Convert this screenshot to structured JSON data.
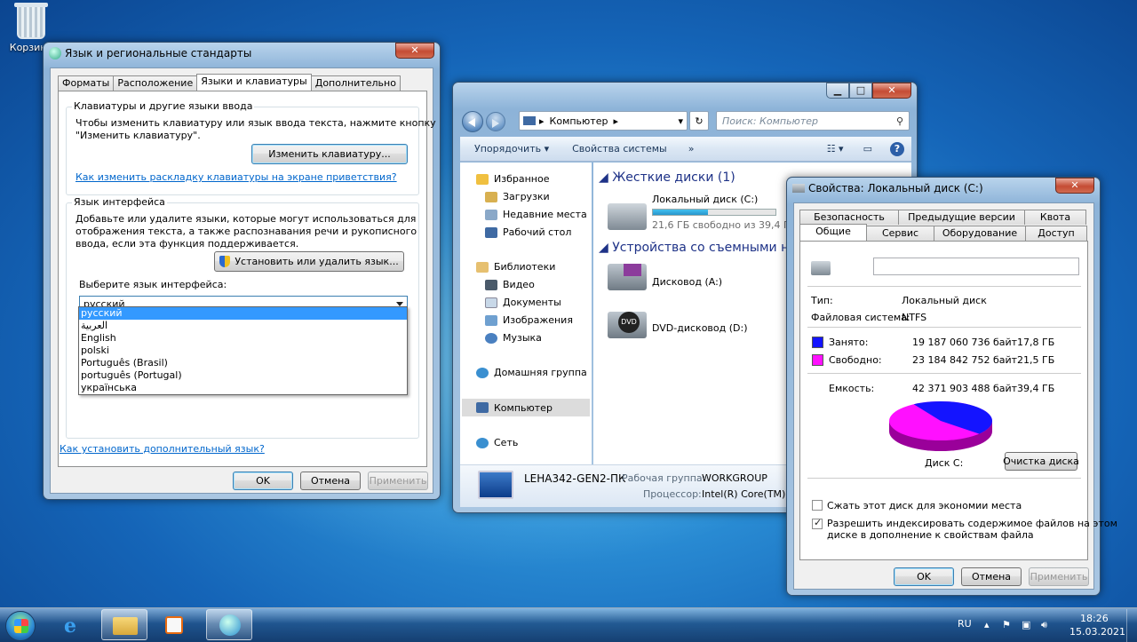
{
  "desktop": {
    "recycle_bin_label": "Корзина"
  },
  "lang_dialog": {
    "title": "Язык и региональные стандарты",
    "tabs": [
      "Форматы",
      "Расположение",
      "Языки и клавиатуры",
      "Дополнительно"
    ],
    "kb_group": {
      "title": "Клавиатуры и другие языки ввода",
      "desc1": "Чтобы изменить клавиатуру или язык ввода текста, нажмите кнопку",
      "desc2": "\"Изменить клавиатуру\".",
      "button": "Изменить клавиатуру...",
      "link": "Как изменить раскладку клавиатуры на экране приветствия?"
    },
    "ui_group": {
      "title": "Язык интерфейса",
      "desc1": "Добавьте или удалите языки, которые могут использоваться для",
      "desc2": "отображения текста, а также распознавания речи и рукописного",
      "desc3": "ввода, если эта функция поддерживается.",
      "button": "Установить или удалить язык...",
      "select_label": "Выберите язык интерфейса:",
      "selected": "русский",
      "options": [
        "русский",
        "العربية",
        "English",
        "polski",
        "Português (Brasil)",
        "português (Portugal)",
        "українська"
      ]
    },
    "link_install": "Как установить дополнительный язык?",
    "ok": "OK",
    "cancel": "Отмена",
    "apply": "Применить"
  },
  "explorer": {
    "breadcrumb": "Компьютер",
    "search_placeholder": "Поиск: Компьютер",
    "commands": [
      "Упорядочить ▾",
      "Свойства системы",
      "»"
    ],
    "nav": {
      "favorites": "Избранное",
      "downloads": "Загрузки",
      "recent": "Недавние места",
      "desktop": "Рабочий стол",
      "libraries": "Библиотеки",
      "video": "Видео",
      "documents": "Документы",
      "images": "Изображения",
      "music": "Музыка",
      "homegroup": "Домашняя группа",
      "computer": "Компьютер",
      "network": "Сеть"
    },
    "hdd_header": "Жесткие диски (1)",
    "local_disk": "Локальный диск (C:)",
    "local_disk_free": "21,6 ГБ свободно из 39,4 ГБ",
    "local_disk_used_pct": 45,
    "removable_header": "Устройства со съемными носителями",
    "floppy": "Дисковод (A:)",
    "dvd": "DVD-дисковод (D:)",
    "dvd_badge": "DVD",
    "pc_name": "LEHA342-GEN2-ПК",
    "workgroup_label": "Рабочая группа:",
    "workgroup": "WORKGROUP",
    "cpu_label": "Процессор:",
    "cpu": "Intel(R) Core(TM) i3"
  },
  "props": {
    "title": "Свойства: Локальный диск (C:)",
    "tabs_top": [
      "Безопасность",
      "Предыдущие версии",
      "Квота"
    ],
    "tabs_bottom": [
      "Общие",
      "Сервис",
      "Оборудование",
      "Доступ"
    ],
    "type_label": "Тип:",
    "type": "Локальный диск",
    "fs_label": "Файловая система:",
    "fs": "NTFS",
    "used_label": "Занято:",
    "used_bytes": "19 187 060 736 байт",
    "used_gb": "17,8 ГБ",
    "free_label": "Свободно:",
    "free_bytes": "23 184 842 752 байт",
    "free_gb": "21,5 ГБ",
    "cap_label": "Емкость:",
    "cap_bytes": "42 371 903 488 байт",
    "cap_gb": "39,4 ГБ",
    "disk_label": "Диск C:",
    "cleanup": "Очистка диска",
    "compress": "Сжать этот диск для экономии места",
    "index1": "Разрешить индексировать содержимое файлов на этом",
    "index2": "диске в дополнение к свойствам файла",
    "used_color": "#1414ff",
    "free_color": "#ff10ff",
    "ok": "OK",
    "cancel": "Отмена",
    "apply": "Применить"
  },
  "taskbar": {
    "lang": "RU",
    "time": "18:26",
    "date": "15.03.2021"
  }
}
